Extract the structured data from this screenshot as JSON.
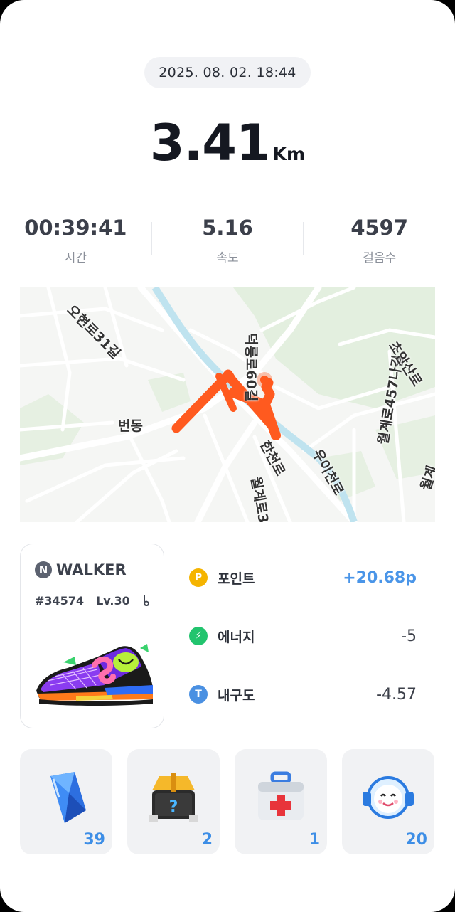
{
  "header": {
    "datetime": "2025. 08. 02. 18:44"
  },
  "summary": {
    "distance": "3.41",
    "distance_unit": "Km"
  },
  "stats": [
    {
      "value": "00:39:41",
      "label": "시간"
    },
    {
      "value": "5.16",
      "label": "속도"
    },
    {
      "value": "4597",
      "label": "걸음수"
    }
  ],
  "map": {
    "labels": {
      "road1": "오현로31길",
      "district": "번동",
      "road2": "덕릉로60길",
      "road3": "한천로",
      "road4": "우이천로",
      "road5": "월계로457나길",
      "road6": "초안산로",
      "road7": "월계로3",
      "road8": "월계"
    },
    "route_color": "#ff5a1f"
  },
  "card": {
    "brand_letter": "N",
    "brand": "WALKER",
    "id": "#34574",
    "level": "Lv.30",
    "icon": "shoe-icon"
  },
  "rewards": [
    {
      "icon_letter": "P",
      "icon": "point-icon",
      "label": "포인트",
      "amount": "+20.68p",
      "color": "#f5b400"
    },
    {
      "icon_letter": "⚡",
      "icon": "energy-icon",
      "label": "에너지",
      "amount": "-5",
      "color": "#22c46e"
    },
    {
      "icon_letter": "T",
      "icon": "durability-icon",
      "label": "내구도",
      "amount": "-4.57",
      "color": "#4a90e2"
    }
  ],
  "items": [
    {
      "icon": "gem-icon",
      "count": "39"
    },
    {
      "icon": "mystery-box-icon",
      "count": "2"
    },
    {
      "icon": "first-aid-kit-icon",
      "count": "1"
    },
    {
      "icon": "character-icon",
      "count": "20"
    }
  ]
}
